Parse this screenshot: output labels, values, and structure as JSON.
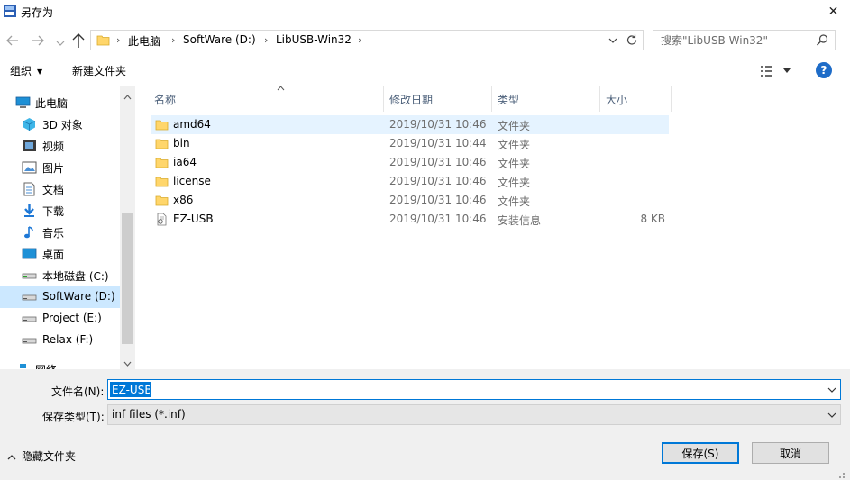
{
  "window": {
    "title": "另存为",
    "close_glyph": "✕"
  },
  "address": {
    "crumbs": [
      "此电脑",
      "SoftWare (D:)",
      "LibUSB-Win32"
    ],
    "separator": "›"
  },
  "search": {
    "placeholder": "搜索\"LibUSB-Win32\""
  },
  "toolbar": {
    "organize_label": "组织",
    "new_folder_label": "新建文件夹",
    "help_label": "?"
  },
  "nav": {
    "items": [
      {
        "label": "此电脑",
        "icon": "computer-icon"
      },
      {
        "label": "3D 对象",
        "icon": "3d-objects-icon"
      },
      {
        "label": "视频",
        "icon": "video-icon"
      },
      {
        "label": "图片",
        "icon": "pictures-icon"
      },
      {
        "label": "文档",
        "icon": "documents-icon"
      },
      {
        "label": "下载",
        "icon": "download-icon"
      },
      {
        "label": "音乐",
        "icon": "music-icon"
      },
      {
        "label": "桌面",
        "icon": "desktop-icon"
      },
      {
        "label": "本地磁盘 (C:)",
        "icon": "drive-icon"
      },
      {
        "label": "SoftWare (D:)",
        "icon": "drive-icon"
      },
      {
        "label": "Project (E:)",
        "icon": "drive-icon"
      },
      {
        "label": "Relax (F:)",
        "icon": "drive-icon"
      },
      {
        "label": "网络",
        "icon": "network-icon"
      }
    ]
  },
  "files": {
    "columns": [
      "名称",
      "修改日期",
      "类型",
      "大小"
    ],
    "rows": [
      {
        "name": "amd64",
        "date": "2019/10/31 10:46",
        "type": "文件夹",
        "size": "",
        "icon": "folder-icon"
      },
      {
        "name": "bin",
        "date": "2019/10/31 10:44",
        "type": "文件夹",
        "size": "",
        "icon": "folder-icon"
      },
      {
        "name": "ia64",
        "date": "2019/10/31 10:46",
        "type": "文件夹",
        "size": "",
        "icon": "folder-icon"
      },
      {
        "name": "license",
        "date": "2019/10/31 10:46",
        "type": "文件夹",
        "size": "",
        "icon": "folder-icon"
      },
      {
        "name": "x86",
        "date": "2019/10/31 10:46",
        "type": "文件夹",
        "size": "",
        "icon": "folder-icon"
      },
      {
        "name": "EZ-USB",
        "date": "2019/10/31 10:46",
        "type": "安装信息",
        "size": "8 KB",
        "icon": "inf-file-icon"
      }
    ]
  },
  "form": {
    "filename_label": "文件名(N):",
    "filename_value": "EZ-USB",
    "filetype_label": "保存类型(T):",
    "filetype_value": "inf files (*.inf)"
  },
  "footer": {
    "hide_folders_label": "隐藏文件夹",
    "save_label": "保存(S)",
    "cancel_label": "取消"
  },
  "colors": {
    "accent": "#0078d7",
    "selection": "#cce8ff",
    "hover_row": "#e5f3ff",
    "folder": "#ffd66b"
  }
}
